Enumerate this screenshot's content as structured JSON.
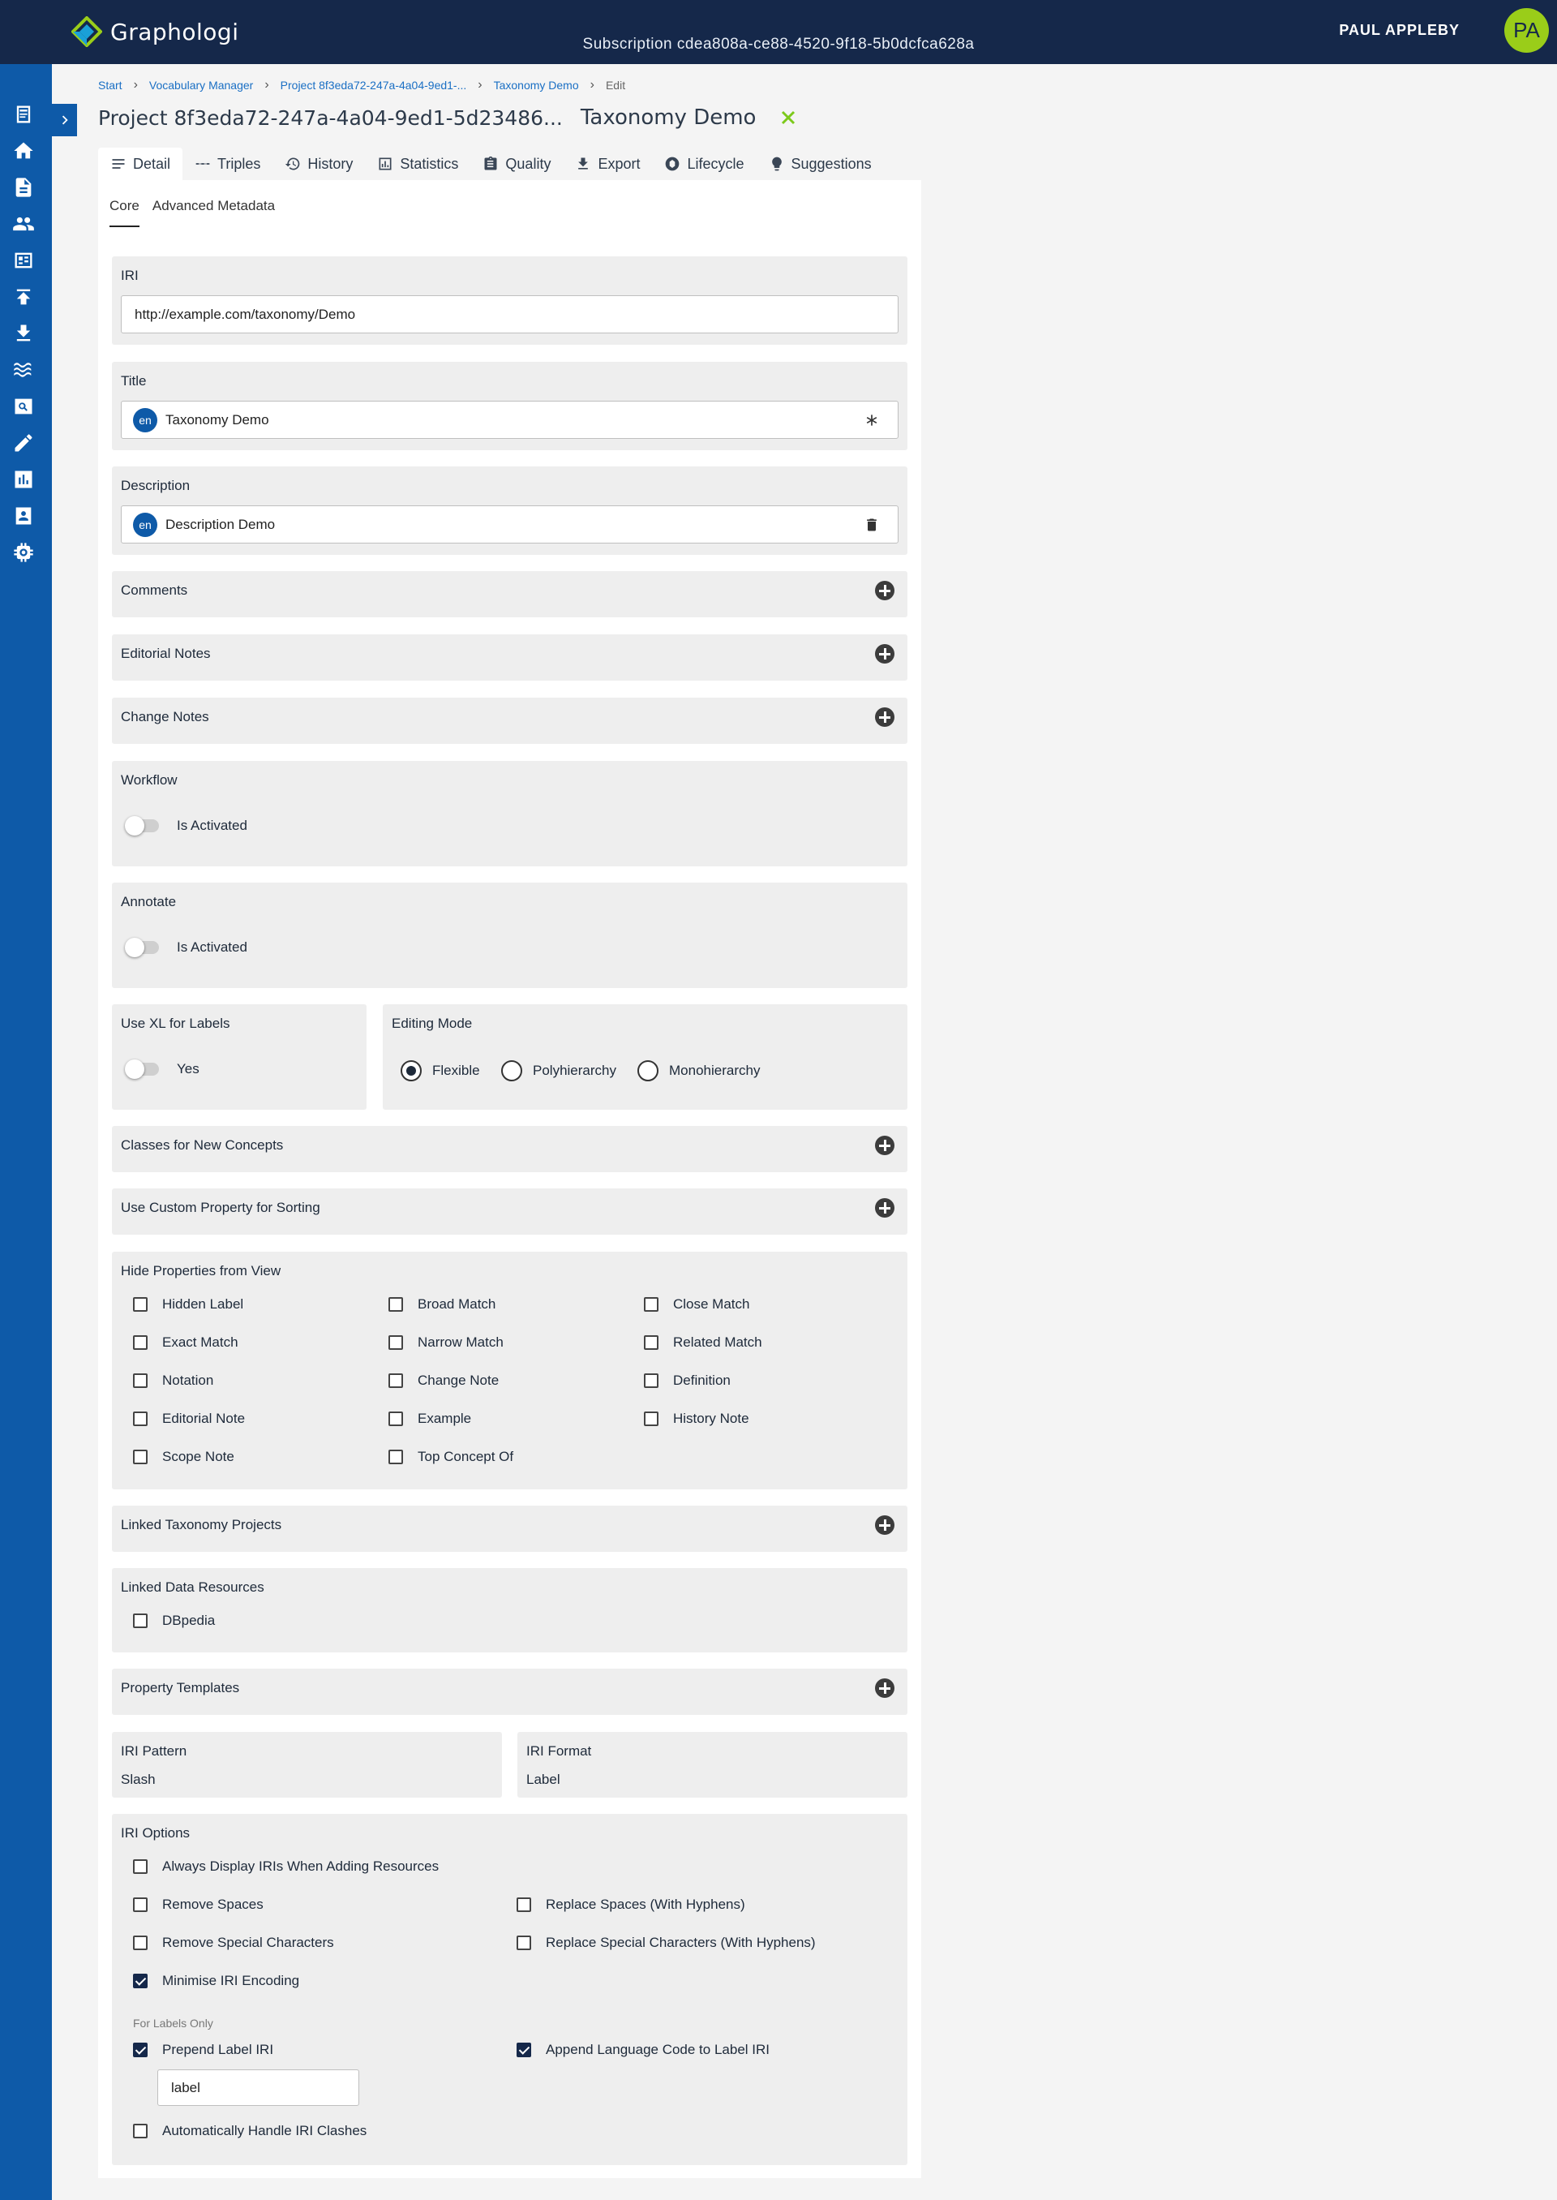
{
  "app": {
    "name": "Graphologi",
    "subscription": "Subscription cdea808a-ce88-4520-9f18-5b0dcfca628a",
    "user_name": "PAUL APPLEBY",
    "user_initials": "PA",
    "brand_color": "#15284a",
    "accent_color": "#9acd19",
    "sidebar_color": "#0e5aa8"
  },
  "sidebar": {
    "items": [
      {
        "icon": "document-outline-icon"
      },
      {
        "icon": "home-icon"
      },
      {
        "icon": "document-icon"
      },
      {
        "icon": "people-icon"
      },
      {
        "icon": "dashboard-icon"
      },
      {
        "icon": "upload-icon"
      },
      {
        "icon": "download-icon"
      },
      {
        "icon": "waves-icon"
      },
      {
        "icon": "image-search-icon"
      },
      {
        "icon": "pencil-icon"
      },
      {
        "icon": "bar-chart-icon"
      },
      {
        "icon": "contact-icon"
      },
      {
        "icon": "settings-chip-icon"
      }
    ]
  },
  "breadcrumb": [
    "Start",
    "Vocabulary Manager",
    "Project 8f3eda72-247a-4a04-9ed1-...",
    "Taxonomy Demo",
    "Edit"
  ],
  "page": {
    "project_title": "Project 8f3eda72-247a-4a04-9ed1-5d23486...",
    "project_name": "Taxonomy Demo"
  },
  "tabs": [
    "Detail",
    "Triples",
    "History",
    "Statistics",
    "Quality",
    "Export",
    "Lifecycle",
    "Suggestions"
  ],
  "subtabs": [
    "Core",
    "Advanced Metadata"
  ],
  "form": {
    "iri_label": "IRI",
    "iri_value": "http://example.com/taxonomy/Demo",
    "title_label": "Title",
    "title_lang": "en",
    "title_value": "Taxonomy Demo",
    "description_label": "Description",
    "description_lang": "en",
    "description_value": "Description Demo",
    "comments": "Comments",
    "editorial_notes": "Editorial Notes",
    "change_notes": "Change Notes",
    "workflow_label": "Workflow",
    "workflow_toggle": "Is Activated",
    "annotate_label": "Annotate",
    "annotate_toggle": "Is Activated",
    "use_xl_label": "Use XL for Labels",
    "use_xl_toggle": "Yes",
    "editing_mode_label": "Editing Mode",
    "editing_modes": [
      "Flexible",
      "Polyhierarchy",
      "Monohierarchy"
    ],
    "editing_mode_selected": "Flexible",
    "classes_new_concepts": "Classes for New Concepts",
    "custom_sort": "Use Custom Property for Sorting",
    "hide_props_label": "Hide Properties from View",
    "hide_props": [
      "Hidden Label",
      "Broad Match",
      "Close Match",
      "Exact Match",
      "Narrow Match",
      "Related Match",
      "Notation",
      "Change Note",
      "Definition",
      "Editorial Note",
      "Example",
      "History Note",
      "Scope Note",
      "Top Concept Of"
    ],
    "linked_taxonomy": "Linked Taxonomy Projects",
    "linked_data_label": "Linked Data Resources",
    "linked_data_option": "DBpedia",
    "property_templates": "Property Templates",
    "iri_pattern_label": "IRI Pattern",
    "iri_pattern_value": "Slash",
    "iri_format_label": "IRI Format",
    "iri_format_value": "Label",
    "iri_options_label": "IRI Options",
    "iri_options": {
      "always_display": "Always Display IRIs When Adding Resources",
      "remove_spaces": "Remove Spaces",
      "replace_spaces": "Replace Spaces (With Hyphens)",
      "remove_special": "Remove Special Characters",
      "replace_special": "Replace Special Characters (With Hyphens)",
      "minimise": "Minimise IRI Encoding",
      "for_labels_only": "For Labels Only",
      "prepend": "Prepend Label IRI",
      "prepend_value": "label",
      "append_lang": "Append Language Code to Label IRI",
      "auto_clash": "Automatically Handle IRI Clashes"
    }
  }
}
